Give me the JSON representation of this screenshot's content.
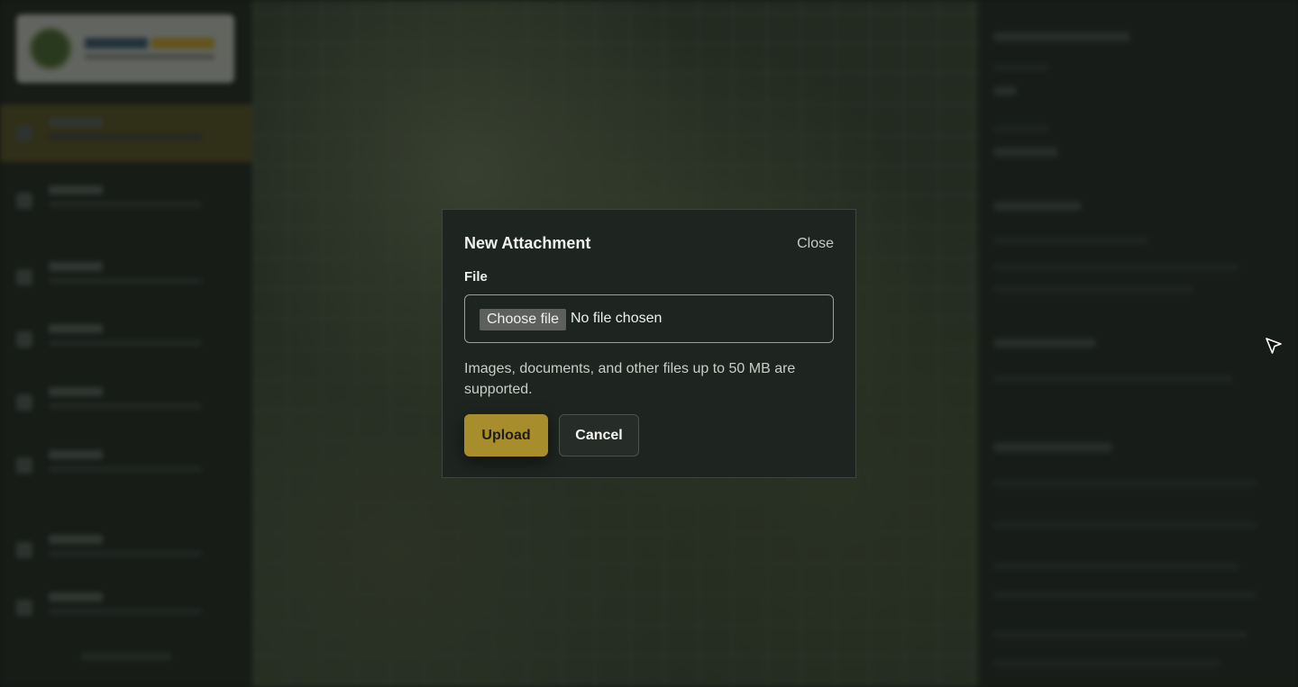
{
  "modal": {
    "title": "New Attachment",
    "close_label": "Close",
    "file_label": "File",
    "choose_file_label": "Choose file",
    "file_status": "No file chosen",
    "help_text": "Images, documents, and other files up to 50 MB are supported.",
    "upload_label": "Upload",
    "cancel_label": "Cancel"
  },
  "colors": {
    "accent": "#a88d2c",
    "modal_bg": "#1e2420",
    "overlay": "rgba(12,16,13,0.55)"
  },
  "icons": {
    "cursor": "mouse-pointer-icon"
  }
}
